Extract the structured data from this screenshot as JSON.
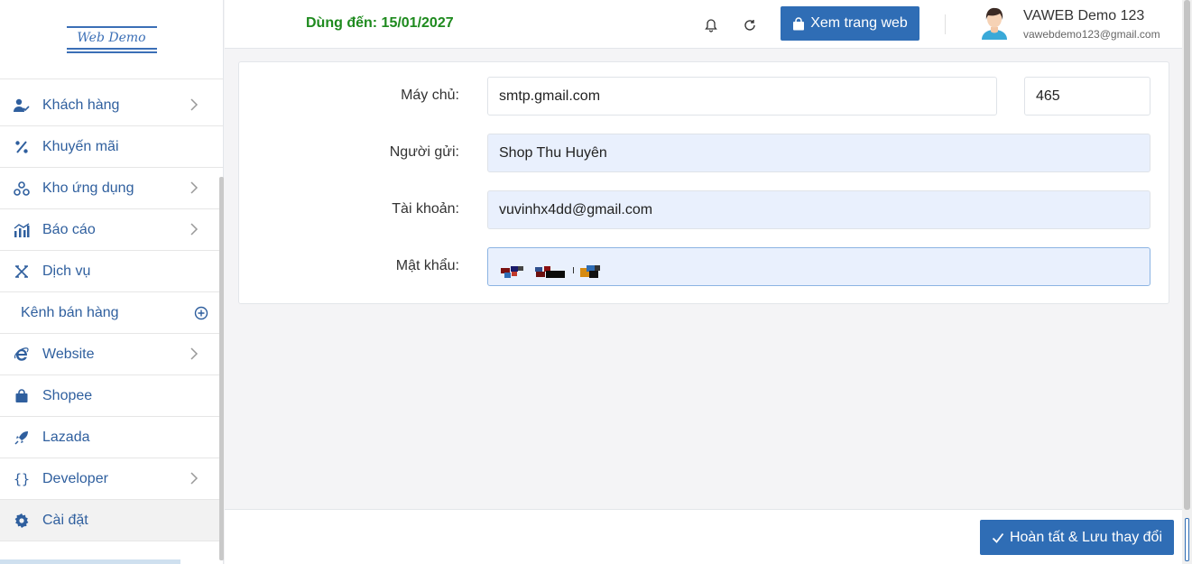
{
  "logo": {
    "text": "Web Demo"
  },
  "sidebar": {
    "items": [
      {
        "label": "Khách hàng",
        "icon": "user-check-icon",
        "has_chevron": true
      },
      {
        "label": "Khuyến mãi",
        "icon": "percent-icon",
        "has_chevron": false
      },
      {
        "label": "Kho ứng dụng",
        "icon": "apps-icon",
        "has_chevron": true
      },
      {
        "label": "Báo cáo",
        "icon": "chart-icon",
        "has_chevron": true
      },
      {
        "label": "Dịch vụ",
        "icon": "service-icon",
        "has_chevron": false
      },
      {
        "label": "Kênh bán hàng",
        "icon": "plus-circle-icon",
        "has_chevron": false
      },
      {
        "label": "Website",
        "icon": "ie-icon",
        "has_chevron": true
      },
      {
        "label": "Shopee",
        "icon": "shopping-bag-icon",
        "has_chevron": false
      },
      {
        "label": "Lazada",
        "icon": "rocket-icon",
        "has_chevron": false
      },
      {
        "label": "Developer",
        "icon": "braces-icon",
        "has_chevron": true
      },
      {
        "label": "Cài đặt",
        "icon": "gear-icon",
        "has_chevron": false,
        "active": true
      }
    ]
  },
  "header": {
    "expiry": "Dùng đến: 15/01/2027",
    "view_site_label": "Xem trang web",
    "user_name": "VAWEB Demo 123",
    "user_email": "vawebdemo123@gmail.com"
  },
  "form": {
    "server_label": "Máy chủ:",
    "server_value": "smtp.gmail.com",
    "port_value": "465",
    "sender_label": "Người gửi:",
    "sender_value": "Shop Thu Huyên",
    "account_label": "Tài khoản:",
    "account_value": "vuvinhx4dd@gmail.com",
    "password_label": "Mật khẩu:"
  },
  "footer": {
    "save_label": "Hoàn tất & Lưu thay đổi"
  },
  "colors": {
    "primary": "#2f6db5",
    "menu_text": "#2f5f9e",
    "expiry": "#1e8a1e",
    "input_filled": "#e9f0fd"
  }
}
